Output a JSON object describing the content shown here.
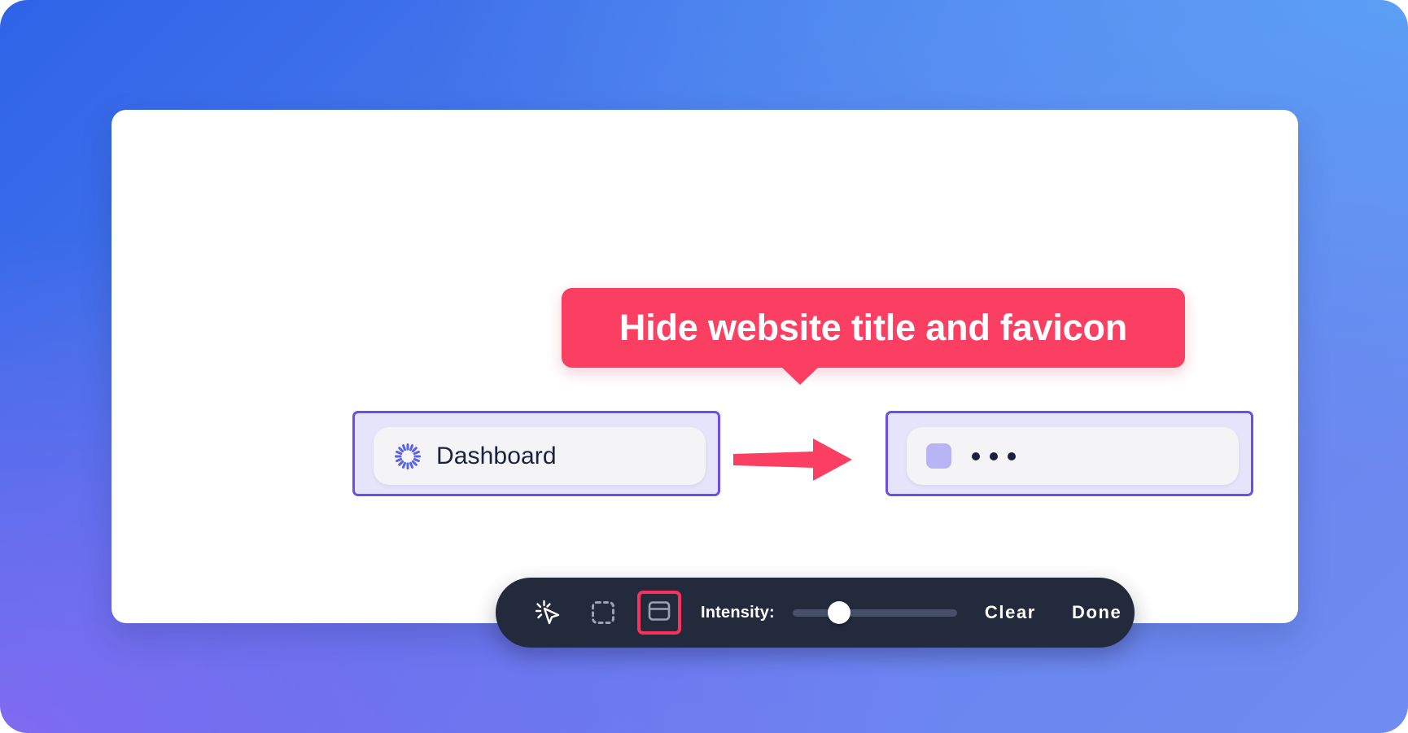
{
  "background": {
    "gradient_from": "#2f63e8",
    "gradient_to": "#6f8df1",
    "accent_purple": "#806af0"
  },
  "callout": {
    "text": "Hide website title and favicon",
    "bg_color": "#fa3f63",
    "text_color": "#ffffff"
  },
  "arrow": {
    "direction": "right",
    "color": "#fa3f63"
  },
  "tabs": {
    "before": {
      "favicon_icon": "sunburst-favicon",
      "favicon_color": "#5b62e8",
      "title": "Dashboard",
      "selection_border_color": "#6d4fe8",
      "selection_fill_color": "#e6e4fb",
      "chip_bg": "#f4f4f6"
    },
    "after": {
      "favicon_icon": "redacted-block-icon",
      "favicon_color": "#b9b5f4",
      "title_redacted_dots": 3,
      "dot_color": "#1c1f3d",
      "selection_border_color": "#6d4fe8",
      "selection_fill_color": "#e6e4fb",
      "chip_bg": "#f4f4f6"
    }
  },
  "toolbar": {
    "bg_color": "#222a3c",
    "tools": [
      {
        "name": "magic-cursor-tool",
        "icon": "magic-cursor-icon",
        "active": false
      },
      {
        "name": "area-select-tool",
        "icon": "dashed-square-icon",
        "active": false
      },
      {
        "name": "window-hide-tool",
        "icon": "browser-window-icon",
        "active": true,
        "highlight_color": "#f8325c"
      }
    ],
    "intensity_label": "Intensity:",
    "intensity_value": 25,
    "intensity_min": 0,
    "intensity_max": 100,
    "slider_track_color": "#46506a",
    "slider_thumb_color": "#ffffff",
    "clear_label": "Clear",
    "done_label": "Done"
  }
}
